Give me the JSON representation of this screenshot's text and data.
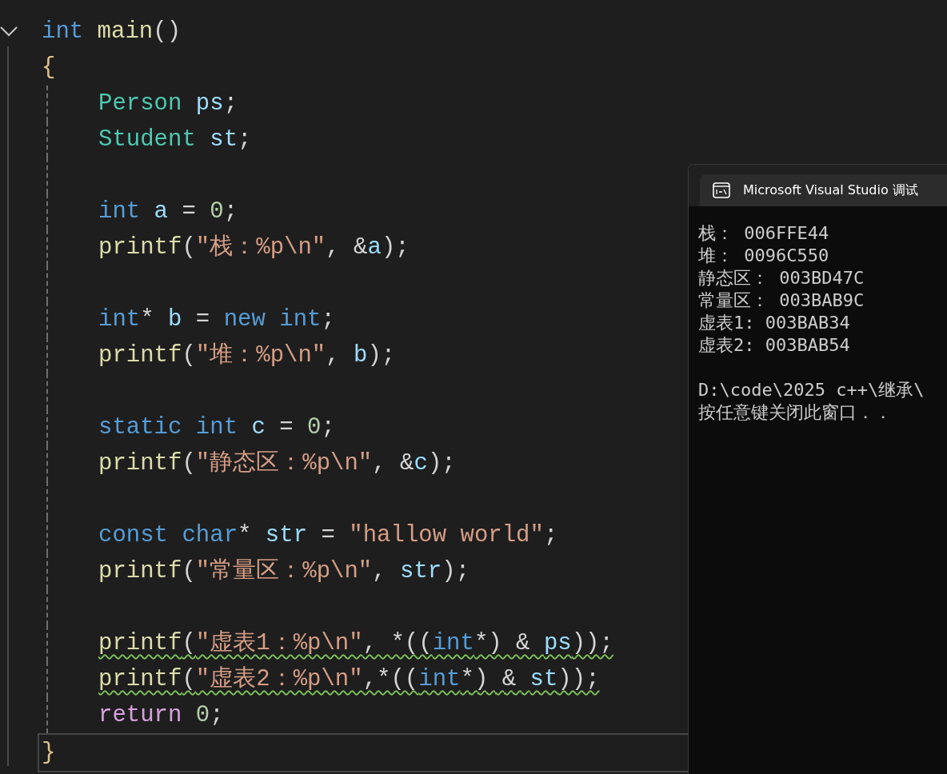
{
  "editor": {
    "expanded": true,
    "lines": [
      {
        "indented": false,
        "warning": false,
        "current": false,
        "tokens": [
          {
            "text": "int",
            "kind": "keyword"
          },
          {
            "text": " main",
            "kind": "function"
          },
          {
            "text": "()",
            "kind": "punct"
          }
        ]
      },
      {
        "indented": false,
        "warning": false,
        "current": false,
        "tokens": [
          {
            "text": "{",
            "kind": "brace"
          }
        ]
      },
      {
        "indented": true,
        "warning": false,
        "current": false,
        "tokens": [
          {
            "text": "Person",
            "kind": "type"
          },
          {
            "text": " ps",
            "kind": "variable"
          },
          {
            "text": ";",
            "kind": "punct"
          }
        ]
      },
      {
        "indented": true,
        "warning": false,
        "current": false,
        "tokens": [
          {
            "text": "Student",
            "kind": "type"
          },
          {
            "text": " st",
            "kind": "variable"
          },
          {
            "text": ";",
            "kind": "punct"
          }
        ]
      },
      {
        "indented": true,
        "current": false
      },
      {
        "indented": true,
        "warning": false,
        "current": false,
        "tokens": [
          {
            "text": "int",
            "kind": "keyword"
          },
          {
            "text": " a",
            "kind": "variable"
          },
          {
            "text": " = ",
            "kind": "punct"
          },
          {
            "text": "0",
            "kind": "number"
          },
          {
            "text": ";",
            "kind": "punct"
          }
        ]
      },
      {
        "indented": true,
        "warning": false,
        "current": false,
        "tokens": [
          {
            "text": "printf",
            "kind": "function"
          },
          {
            "text": "(",
            "kind": "punct"
          },
          {
            "text": "\"栈：%p\\n\"",
            "kind": "string"
          },
          {
            "text": ", &",
            "kind": "punct"
          },
          {
            "text": "a",
            "kind": "variable"
          },
          {
            "text": ");",
            "kind": "punct"
          }
        ]
      },
      {
        "indented": true,
        "current": false
      },
      {
        "indented": true,
        "warning": false,
        "current": false,
        "tokens": [
          {
            "text": "int",
            "kind": "keyword"
          },
          {
            "text": "* ",
            "kind": "punct"
          },
          {
            "text": "b",
            "kind": "variable"
          },
          {
            "text": " = ",
            "kind": "punct"
          },
          {
            "text": "new",
            "kind": "keyword"
          },
          {
            "text": " int",
            "kind": "keyword"
          },
          {
            "text": ";",
            "kind": "punct"
          }
        ]
      },
      {
        "indented": true,
        "warning": false,
        "current": false,
        "tokens": [
          {
            "text": "printf",
            "kind": "function"
          },
          {
            "text": "(",
            "kind": "punct"
          },
          {
            "text": "\"堆：%p\\n\"",
            "kind": "string"
          },
          {
            "text": ", ",
            "kind": "punct"
          },
          {
            "text": "b",
            "kind": "variable"
          },
          {
            "text": ");",
            "kind": "punct"
          }
        ]
      },
      {
        "indented": true,
        "current": false
      },
      {
        "indented": true,
        "warning": false,
        "current": false,
        "tokens": [
          {
            "text": "static",
            "kind": "keyword"
          },
          {
            "text": " int",
            "kind": "keyword"
          },
          {
            "text": " c",
            "kind": "variable"
          },
          {
            "text": " = ",
            "kind": "punct"
          },
          {
            "text": "0",
            "kind": "number"
          },
          {
            "text": ";",
            "kind": "punct"
          }
        ]
      },
      {
        "indented": true,
        "warning": false,
        "current": false,
        "tokens": [
          {
            "text": "printf",
            "kind": "function"
          },
          {
            "text": "(",
            "kind": "punct"
          },
          {
            "text": "\"静态区：%p\\n\"",
            "kind": "string"
          },
          {
            "text": ", &",
            "kind": "punct"
          },
          {
            "text": "c",
            "kind": "variable"
          },
          {
            "text": ");",
            "kind": "punct"
          }
        ]
      },
      {
        "indented": true,
        "current": false
      },
      {
        "indented": true,
        "warning": false,
        "current": false,
        "tokens": [
          {
            "text": "const",
            "kind": "keyword"
          },
          {
            "text": " char",
            "kind": "keyword"
          },
          {
            "text": "* ",
            "kind": "punct"
          },
          {
            "text": "str",
            "kind": "variable"
          },
          {
            "text": " = ",
            "kind": "punct"
          },
          {
            "text": "\"hallow world\"",
            "kind": "string"
          },
          {
            "text": ";",
            "kind": "punct"
          }
        ]
      },
      {
        "indented": true,
        "warning": false,
        "current": false,
        "tokens": [
          {
            "text": "printf",
            "kind": "function"
          },
          {
            "text": "(",
            "kind": "punct"
          },
          {
            "text": "\"常量区：%p\\n\"",
            "kind": "string"
          },
          {
            "text": ", ",
            "kind": "punct"
          },
          {
            "text": "str",
            "kind": "variable"
          },
          {
            "text": ");",
            "kind": "punct"
          }
        ]
      },
      {
        "indented": true,
        "current": false
      },
      {
        "indented": true,
        "warning": true,
        "current": false,
        "tokens": [
          {
            "text": "printf",
            "kind": "function"
          },
          {
            "text": "(",
            "kind": "punct"
          },
          {
            "text": "\"虚表1：%p\\n\"",
            "kind": "string"
          },
          {
            "text": ", *((",
            "kind": "punct"
          },
          {
            "text": "int",
            "kind": "keyword"
          },
          {
            "text": "*) & ",
            "kind": "punct"
          },
          {
            "text": "ps",
            "kind": "variable"
          },
          {
            "text": "));",
            "kind": "punct"
          }
        ]
      },
      {
        "indented": true,
        "warning": true,
        "current": false,
        "tokens": [
          {
            "text": "printf",
            "kind": "function"
          },
          {
            "text": "(",
            "kind": "punct"
          },
          {
            "text": "\"虚表2：%p\\n\"",
            "kind": "string"
          },
          {
            "text": ",*((",
            "kind": "punct"
          },
          {
            "text": "int",
            "kind": "keyword"
          },
          {
            "text": "*) & ",
            "kind": "punct"
          },
          {
            "text": "st",
            "kind": "variable"
          },
          {
            "text": "));",
            "kind": "punct"
          }
        ]
      },
      {
        "indented": true,
        "warning": false,
        "current": false,
        "tokens": [
          {
            "text": "return",
            "kind": "control"
          },
          {
            "text": " 0",
            "kind": "number"
          },
          {
            "text": ";",
            "kind": "punct"
          }
        ]
      },
      {
        "indented": false,
        "warning": false,
        "current": true,
        "tokens": [
          {
            "text": "}",
            "kind": "brace"
          }
        ]
      }
    ]
  },
  "console": {
    "title": "Microsoft Visual Studio 调试",
    "output": [
      "栈： 006FFE44",
      "堆： 0096C550",
      "静态区： 003BD47C",
      "常量区： 003BAB9C",
      "虚表1: 003BAB34",
      "虚表2: 003BAB54"
    ],
    "footer": [
      "D:\\code\\2025 c++\\继承\\",
      "按任意键关闭此窗口．．"
    ]
  }
}
